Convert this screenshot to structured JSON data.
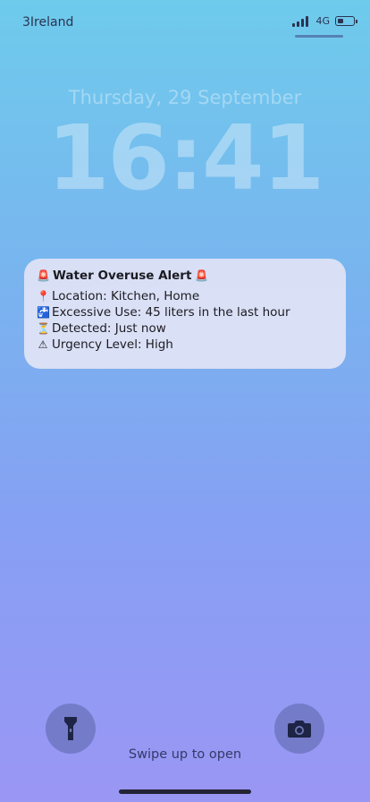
{
  "status_bar": {
    "carrier": "3Ireland",
    "network": "4G",
    "battery_level": 0.35,
    "signal_bars": 4
  },
  "lock_screen": {
    "date": "Thursday, 29 September",
    "time": "16:41"
  },
  "notification": {
    "title": "Water Overuse Alert",
    "title_icon": "siren-emoji",
    "lines": [
      {
        "icon": "pushpin-emoji",
        "text": "Location: Kitchen, Home"
      },
      {
        "icon": "water-tap-emoji",
        "text": "Excessive Use: 45 liters in the last hour"
      },
      {
        "icon": "hourglass-emoji",
        "text": "Detected: Just now"
      },
      {
        "icon": "warning-emoji",
        "text": "Urgency Level: High"
      }
    ]
  },
  "controls": {
    "flashlight_icon": "flashlight-icon",
    "camera_icon": "camera-icon",
    "swipe_hint": "Swipe up to open"
  },
  "colors": {
    "background_top": "#6ecbec",
    "background_bottom": "#9a96f4",
    "notification_bg": "#e2e4f5",
    "text_dark": "#1b1b22",
    "status_text": "#2b3350"
  }
}
